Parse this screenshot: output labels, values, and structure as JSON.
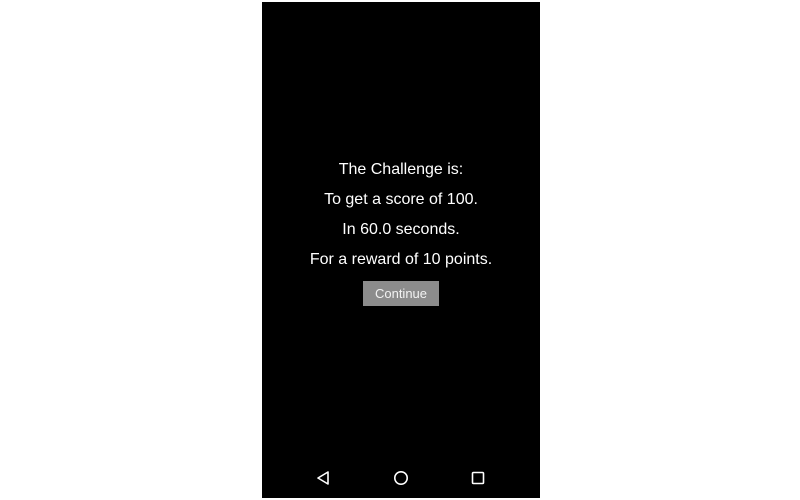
{
  "challenge": {
    "heading": "The Challenge is:",
    "score_line": "To get a score of 100.",
    "time_line": "In 60.0 seconds.",
    "reward_line": "For a reward of 10 points.",
    "continue_label": "Continue"
  },
  "navbar": {
    "back_icon": "back-triangle-icon",
    "home_icon": "home-circle-icon",
    "recents_icon": "recents-square-icon"
  },
  "colors": {
    "screen_bg": "#000000",
    "text": "#ffffff",
    "button_bg": "#8c8c8c",
    "button_text": "#f2f2f2",
    "nav_icon": "#ffffff"
  }
}
